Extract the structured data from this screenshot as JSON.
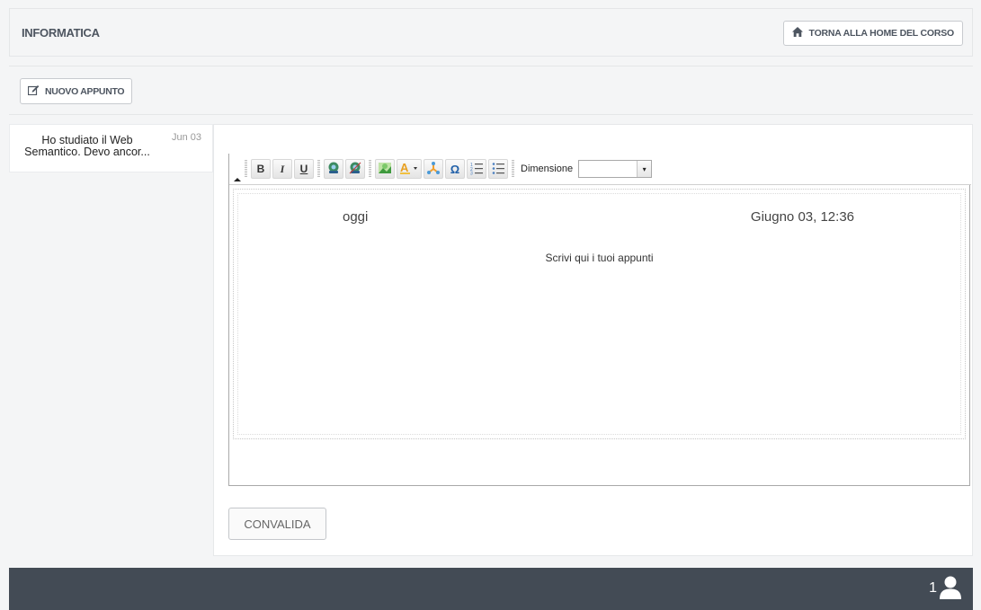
{
  "header": {
    "title": "INFORMATICA",
    "home_button": "TORNA ALLA HOME DEL CORSO",
    "home_icon": "home-icon"
  },
  "toolbar": {
    "new_note_button": "NUOVO APPUNTO",
    "new_note_icon": "edit-icon"
  },
  "notes": [
    {
      "text": "Ho studiato il Web Semantico. Devo ancor...",
      "date": "Jun 03"
    }
  ],
  "editor": {
    "toolbar": {
      "bold": "B",
      "italic": "I",
      "underline": "U",
      "special_char": "Ω",
      "size_label": "Dimensione",
      "size_value": ""
    },
    "today_label": "oggi",
    "date_label": "Giugno 03, 12:36",
    "placeholder": "Scrivi qui i tuoi appunti"
  },
  "actions": {
    "validate": "CONVALIDA"
  },
  "footer": {
    "user_count": "1",
    "background": "#434b55"
  }
}
